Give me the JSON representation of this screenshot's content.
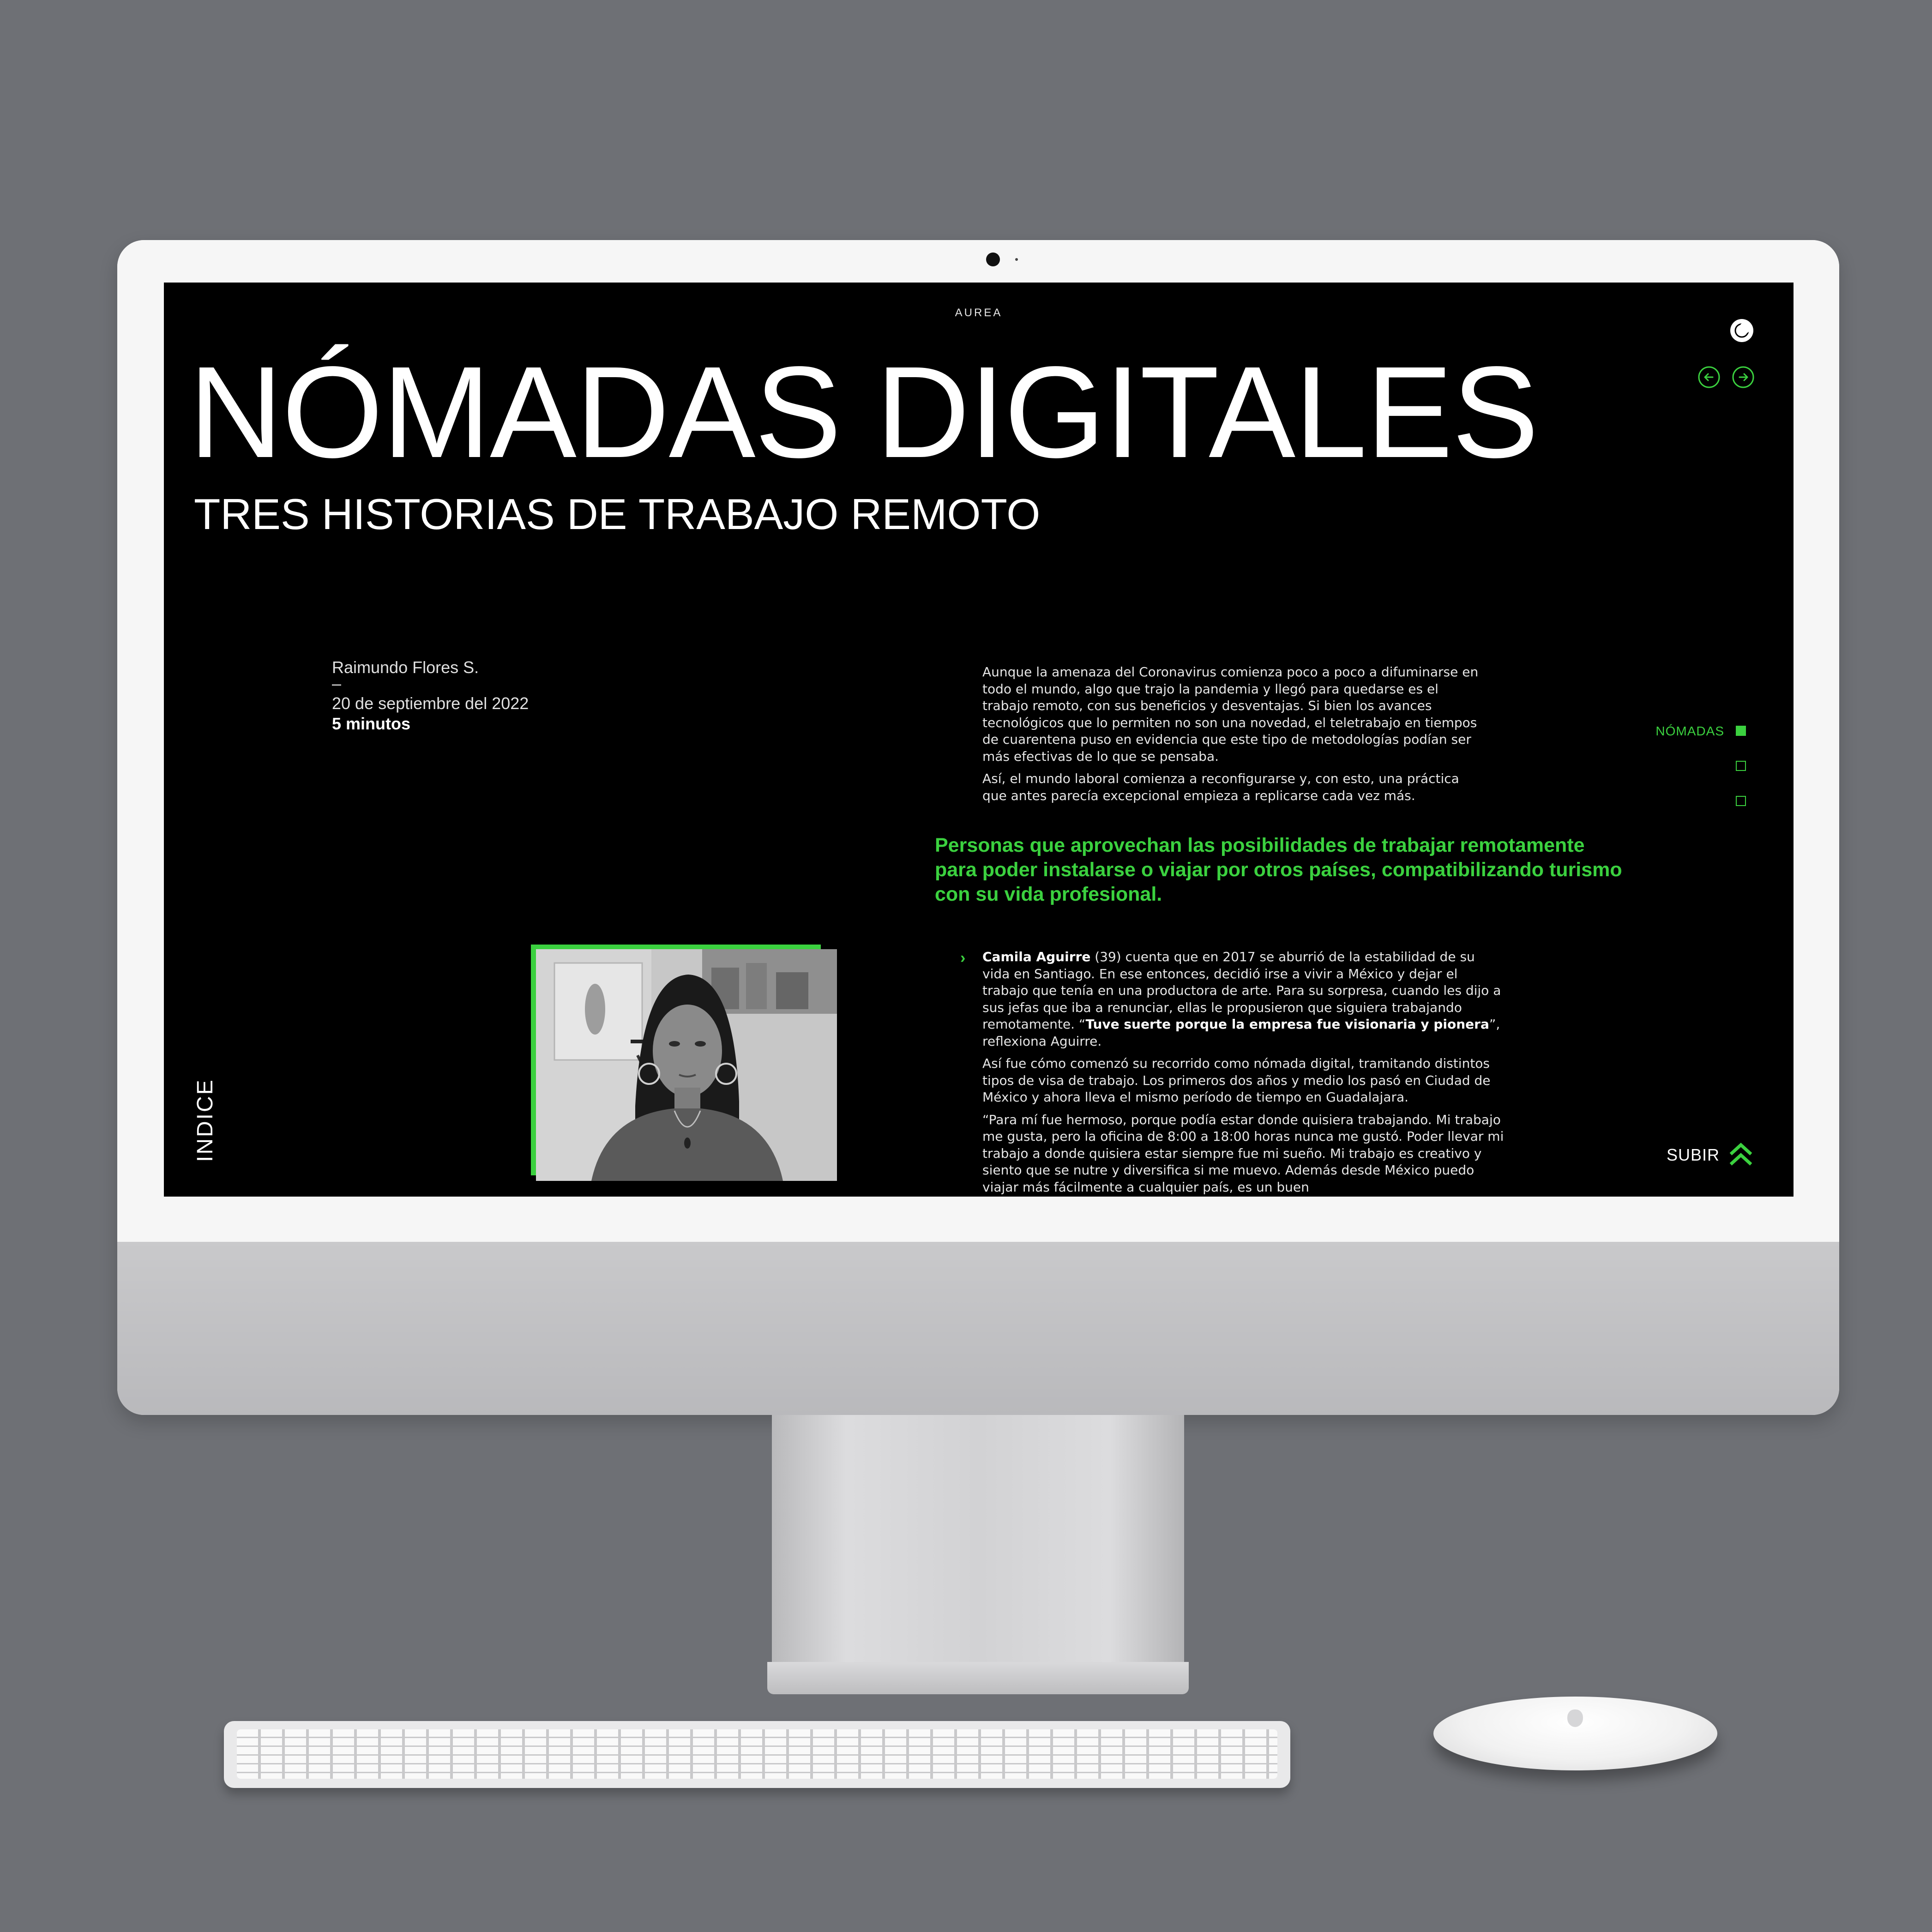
{
  "site": {
    "brand": "AUREA"
  },
  "article": {
    "title": "NÓMADAS DIGITALES",
    "subtitle": "TRES HISTORIAS DE TRABAJO REMOTO",
    "author": "Raimundo Flores S.",
    "separator": "–",
    "date": "20 de septiembre del 2022",
    "read_time": "5 minutos",
    "intro": [
      "Aunque la amenaza del Coronavirus comienza poco a poco a difuminarse en todo el mundo, algo que trajo la pandemia y llegó para quedarse es el trabajo remoto, con sus beneficios y desventajas. Si bien los avances tecnológicos que lo permiten no son una novedad, el teletrabajo en tiempos de cuarentena puso en evidencia que este tipo de metodologías podían ser más efectivas de lo que se pensaba.",
      "Así, el mundo laboral comienza a reconfigurarse y, con esto, una práctica que antes parecía excepcional empieza a replicarse cada vez más."
    ],
    "pullquote": "Personas que aprovechan las posibilidades de trabajar remotamente para poder instalarse o viajar por otros países, compatibilizando turismo con su vida profesional.",
    "story": {
      "chevron": "›",
      "name": "Camila Aguirre",
      "p1_a": " (39) cuenta que en 2017 se aburrió de la estabilidad de su vida en Santiago. En ese entonces, decidió irse a vivir a México y dejar el trabajo que tenía en una productora de arte. Para su sorpresa, cuando les dijo a sus jefas que iba a renunciar, ellas le propusieron que siguiera trabajando remotamente. “",
      "quote_bold": "Tuve suerte porque la empresa fue visionaria y pionera",
      "p1_b": "”, reflexiona Aguirre.",
      "p2": "Así fue cómo comenzó su recorrido como nómada digital, tramitando distintos tipos de visa de trabajo. Los primeros dos años y medio los pasó en Ciudad de México y ahora lleva el mismo período de tiempo en Guadalajara.",
      "p3": "“Para mí fue hermoso, porque podía estar donde quisiera trabajando. Mi trabajo me gusta, pero la oficina de 8:00 a 18:00 horas nunca me gustó. Poder llevar mi trabajo a donde quisiera estar siempre fue mi sueño. Mi trabajo es creativo y siento que se nutre y diversifica si me muevo. Además desde México puedo viajar más fácilmente a cualquier país, es un buen"
    }
  },
  "section_nav": {
    "items": [
      {
        "label": "NÓMADAS",
        "active": true
      },
      {
        "label": "",
        "active": false
      },
      {
        "label": "",
        "active": false
      }
    ]
  },
  "controls": {
    "index_label": "INDICE",
    "scroll_top_label": "SUBIR",
    "theme_toggle_icon": "moon-icon",
    "prev_icon": "arrow-left-icon",
    "next_icon": "arrow-right-icon",
    "scroll_top_icon": "double-chevron-up-icon"
  },
  "colors": {
    "accent": "#3bd13f",
    "background": "#000000",
    "text": "#ffffff"
  }
}
